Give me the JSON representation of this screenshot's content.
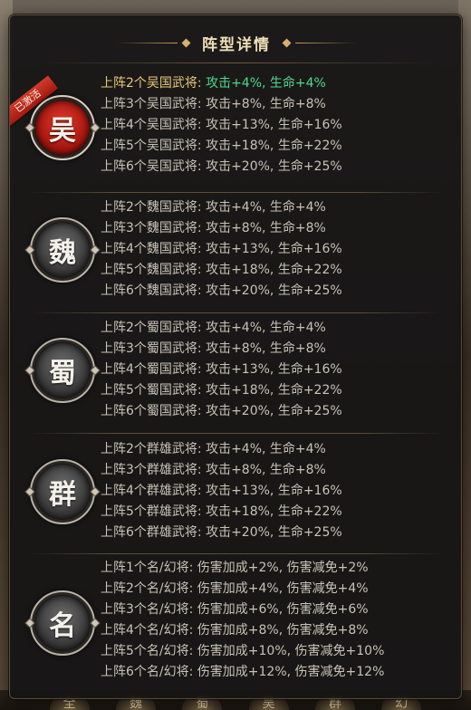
{
  "title": "阵型详情",
  "active_ribbon": "已激活",
  "groups": [
    {
      "badge": "吴",
      "active": true,
      "lines": [
        {
          "label": "上阵2个吴国武将: ",
          "value": "攻击+4%, 生命+4%"
        },
        {
          "label": "上阵3个吴国武将: ",
          "value": "攻击+8%, 生命+8%"
        },
        {
          "label": "上阵4个吴国武将: ",
          "value": "攻击+13%, 生命+16%"
        },
        {
          "label": "上阵5个吴国武将: ",
          "value": "攻击+18%, 生命+22%"
        },
        {
          "label": "上阵6个吴国武将: ",
          "value": "攻击+20%, 生命+25%"
        }
      ]
    },
    {
      "badge": "魏",
      "active": false,
      "lines": [
        {
          "label": "上阵2个魏国武将: ",
          "value": "攻击+4%, 生命+4%"
        },
        {
          "label": "上阵3个魏国武将: ",
          "value": "攻击+8%, 生命+8%"
        },
        {
          "label": "上阵4个魏国武将: ",
          "value": "攻击+13%, 生命+16%"
        },
        {
          "label": "上阵5个魏国武将: ",
          "value": "攻击+18%, 生命+22%"
        },
        {
          "label": "上阵6个魏国武将: ",
          "value": "攻击+20%, 生命+25%"
        }
      ]
    },
    {
      "badge": "蜀",
      "active": false,
      "lines": [
        {
          "label": "上阵2个蜀国武将: ",
          "value": "攻击+4%, 生命+4%"
        },
        {
          "label": "上阵3个蜀国武将: ",
          "value": "攻击+8%, 生命+8%"
        },
        {
          "label": "上阵4个蜀国武将: ",
          "value": "攻击+13%, 生命+16%"
        },
        {
          "label": "上阵5个蜀国武将: ",
          "value": "攻击+18%, 生命+22%"
        },
        {
          "label": "上阵6个蜀国武将: ",
          "value": "攻击+20%, 生命+25%"
        }
      ]
    },
    {
      "badge": "群",
      "active": false,
      "lines": [
        {
          "label": "上阵2个群雄武将: ",
          "value": "攻击+4%, 生命+4%"
        },
        {
          "label": "上阵3个群雄武将: ",
          "value": "攻击+8%, 生命+8%"
        },
        {
          "label": "上阵4个群雄武将: ",
          "value": "攻击+13%, 生命+16%"
        },
        {
          "label": "上阵5个群雄武将: ",
          "value": "攻击+18%, 生命+22%"
        },
        {
          "label": "上阵6个群雄武将: ",
          "value": "攻击+20%, 生命+25%"
        }
      ]
    },
    {
      "badge": "名",
      "active": false,
      "lines": [
        {
          "label": "上阵1个名/幻将: ",
          "value": "伤害加成+2%, 伤害减免+2%"
        },
        {
          "label": "上阵2个名/幻将: ",
          "value": "伤害加成+4%, 伤害减免+4%"
        },
        {
          "label": "上阵3个名/幻将: ",
          "value": "伤害加成+6%, 伤害减免+6%"
        },
        {
          "label": "上阵4个名/幻将: ",
          "value": "伤害加成+8%, 伤害减免+8%"
        },
        {
          "label": "上阵5个名/幻将: ",
          "value": "伤害加成+10%, 伤害减免+10%"
        },
        {
          "label": "上阵6个名/幻将: ",
          "value": "伤害加成+12%, 伤害减免+12%"
        }
      ]
    }
  ],
  "bottom_tabs": [
    "全",
    "魏",
    "蜀",
    "吴",
    "群",
    "幻"
  ],
  "colors": {
    "active_label": "#e5c878",
    "active_value": "#4ed98a",
    "inactive_text": "#c9c2b6",
    "active_badge": "#c0261a",
    "inactive_badge": "#3b3b3b"
  }
}
